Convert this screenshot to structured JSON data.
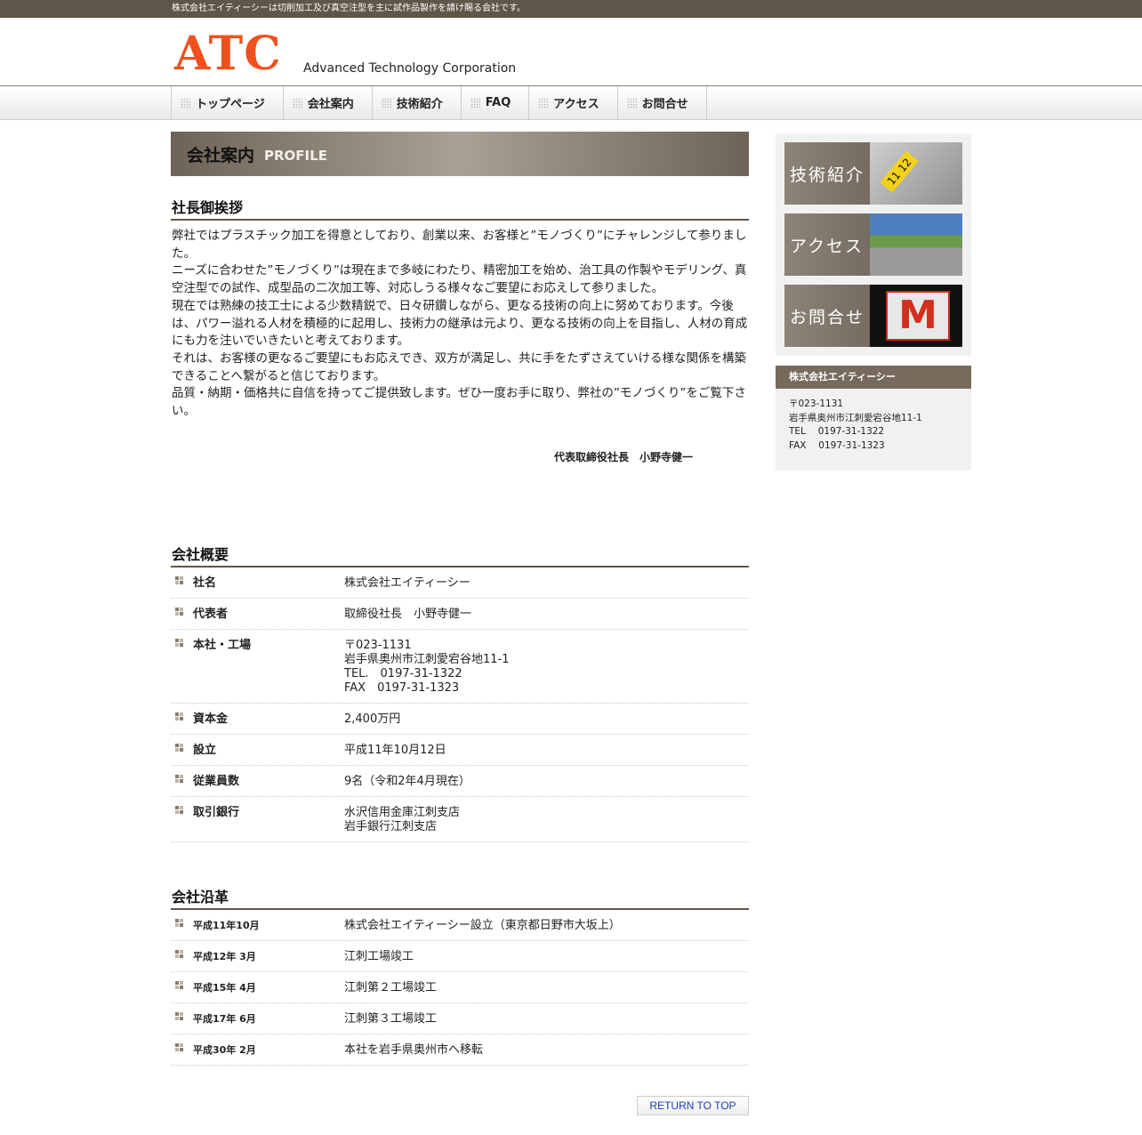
{
  "topbar": {
    "text": "株式会社エイティーシーは切削加工及び真空注型を主に試作品製作を請け賜る会社です。"
  },
  "header": {
    "logo_main": "ATC",
    "logo_sub": "Advanced Technology Corporation"
  },
  "nav": {
    "items": [
      "トップページ",
      "会社案内",
      "技術紹介",
      "FAQ",
      "アクセス",
      "お問合せ"
    ]
  },
  "page": {
    "title_jp": "会社案内",
    "title_en": "PROFILE"
  },
  "greeting": {
    "heading": "社長御挨拶",
    "paragraphs": [
      "弊社ではプラスチック加工を得意としており、創業以来、お客様と”モノづくり”にチャレンジして参りました。",
      "ニーズに合わせた”モノづくり”は現在まで多岐にわたり、精密加工を始め、治工具の作製やモデリング、真空注型での試作、成型品の二次加工等、対応しうる様々なご要望にお応えして参りました。",
      "現在では熟練の技工士による少数精鋭で、日々研鑽しながら、更なる技術の向上に努めております。今後は、パワー溢れる人材を積極的に起用し、技術力の継承は元より、更なる技術の向上を目指し、人材の育成にも力を注いでいきたいと考えております。",
      "それは、お客様の更なるご要望にもお応えでき、双方が満足し、共に手をたずさえていける様な関係を構築できることへ繋がると信じております。",
      "品質・納期・価格共に自信を持ってご提供致します。ぜひ一度お手に取り、弊社の”モノづくり”をご覧下さい。"
    ],
    "signature": "代表取締役社長　小野寺健一"
  },
  "outline": {
    "heading": "会社概要",
    "rows": [
      {
        "label": "社名",
        "value": "株式会社エイティーシー"
      },
      {
        "label": "代表者",
        "value": "取締役社長　小野寺健一"
      },
      {
        "label": "本社・工場",
        "value": "〒023-1131\n岩手県奥州市江刺愛宕谷地11-1\nTEL.　0197-31-1322\nFAX　0197-31-1323"
      },
      {
        "label": "資本金",
        "value": "2,400万円"
      },
      {
        "label": "設立",
        "value": "平成11年10月12日"
      },
      {
        "label": "従業員数",
        "value": "9名（令和2年4月現在）"
      },
      {
        "label": "取引銀行",
        "value": "水沢信用金庫江刺支店\n岩手銀行江刺支店"
      }
    ]
  },
  "history": {
    "heading": "会社沿革",
    "rows": [
      {
        "label": "平成11年10月",
        "value": "株式会社エイティーシー設立（東京都日野市大坂上）"
      },
      {
        "label": "平成12年 3月",
        "value": "江刺工場竣工"
      },
      {
        "label": "平成15年 4月",
        "value": "江刺第２工場竣工"
      },
      {
        "label": "平成17年 6月",
        "value": "江刺第３工場竣工"
      },
      {
        "label": "平成30年 2月",
        "value": "本社を岩手県奥州市へ移転"
      }
    ]
  },
  "to_top": "RETURN TO TOP",
  "sidebar": {
    "banners": [
      {
        "label": "技術紹介",
        "icon": "gear-parts-photo"
      },
      {
        "label": "アクセス",
        "icon": "building-photo"
      },
      {
        "label": "お問合せ",
        "icon": "mail-icon"
      }
    ],
    "company": {
      "title": "株式会社エイティーシー",
      "lines": [
        "〒023-1131",
        "岩手県奥州市江刺愛宕谷地11-1",
        "TEL　 0197-31-1322",
        "FAX　 0197-31-1323"
      ]
    }
  }
}
